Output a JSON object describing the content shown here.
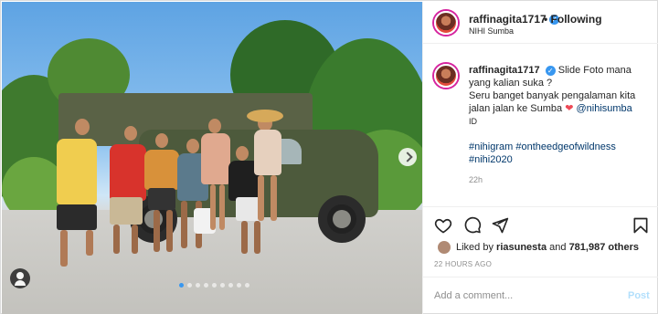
{
  "post": {
    "username": "raffinagita1717",
    "verified_mark": "✓",
    "follow_status": "• Following",
    "location": "NIHI Sumba"
  },
  "caption": {
    "username": "raffinagita1717",
    "line1": "Slide Foto mana yang kalian suka ?",
    "line2": "Seru banget banyak pengalaman kita jalan jalan ke Sumba",
    "heart": "❤",
    "mention": "@nihisumba",
    "suffix": "ID",
    "hashtags": "#nihigram #ontheedgeofwildness #nihi2020",
    "age": "22h"
  },
  "engagement": {
    "liked_by_prefix": "Liked by",
    "liked_by_user": "riasunesta",
    "liked_by_joiner": "and",
    "others_count": "781,987 others",
    "posted_ago": "22 HOURS AGO"
  },
  "comment": {
    "placeholder": "Add a comment...",
    "post_label": "Post"
  },
  "carousel": {
    "slides": 9,
    "active_index": 0
  },
  "icons": {
    "like": "heart-outline-icon",
    "comment": "comment-bubble-icon",
    "share": "paper-plane-icon",
    "save": "bookmark-icon",
    "tag": "person-tag-icon",
    "next": "chevron-right-icon"
  },
  "colors": {
    "verified_blue": "#3897f0",
    "link": "#00376b",
    "heart": "#ed4956",
    "muted": "#8e8e8e",
    "post_disabled": "#b2dffc"
  }
}
